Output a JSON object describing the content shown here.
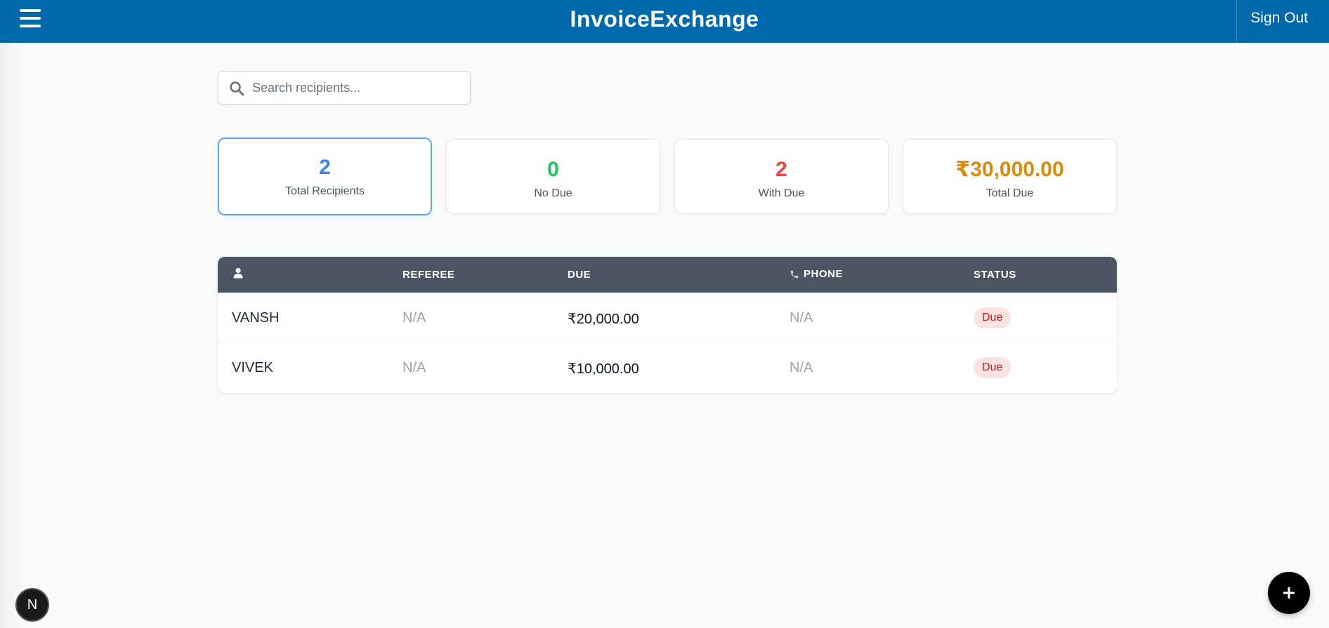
{
  "header": {
    "title": "InvoiceExchange",
    "sign_out_label": "Sign Out"
  },
  "search": {
    "placeholder": "Search recipients...",
    "value": ""
  },
  "stats": [
    {
      "value": "2",
      "label": "Total Recipients",
      "color": "#3b82f6",
      "active": true
    },
    {
      "value": "0",
      "label": "No Due",
      "color": "#22c55e",
      "active": false
    },
    {
      "value": "2",
      "label": "With Due",
      "color": "#ef4444",
      "active": false
    },
    {
      "value": "₹30,000.00",
      "label": "Total Due",
      "color": "#d98a0a",
      "active": false
    }
  ],
  "table": {
    "columns": {
      "name_icon": "user-icon",
      "referee": "REFEREE",
      "due": "DUE",
      "phone": "PHONE",
      "phone_icon": "phone-icon",
      "status": "STATUS"
    },
    "rows": [
      {
        "name": "VANSH",
        "referee": "N/A",
        "due": "₹20,000.00",
        "phone": "N/A",
        "status": "Due"
      },
      {
        "name": "VIVEK",
        "referee": "N/A",
        "due": "₹10,000.00",
        "phone": "N/A",
        "status": "Due"
      }
    ]
  },
  "fab": {
    "icon": "plus-icon"
  },
  "dev_badge": {
    "label": "N"
  },
  "colors": {
    "header_bg": "#0069ac",
    "table_header_bg": "#4b5563",
    "due_badge_bg": "#fde2e2",
    "due_badge_text": "#c81e1e"
  }
}
